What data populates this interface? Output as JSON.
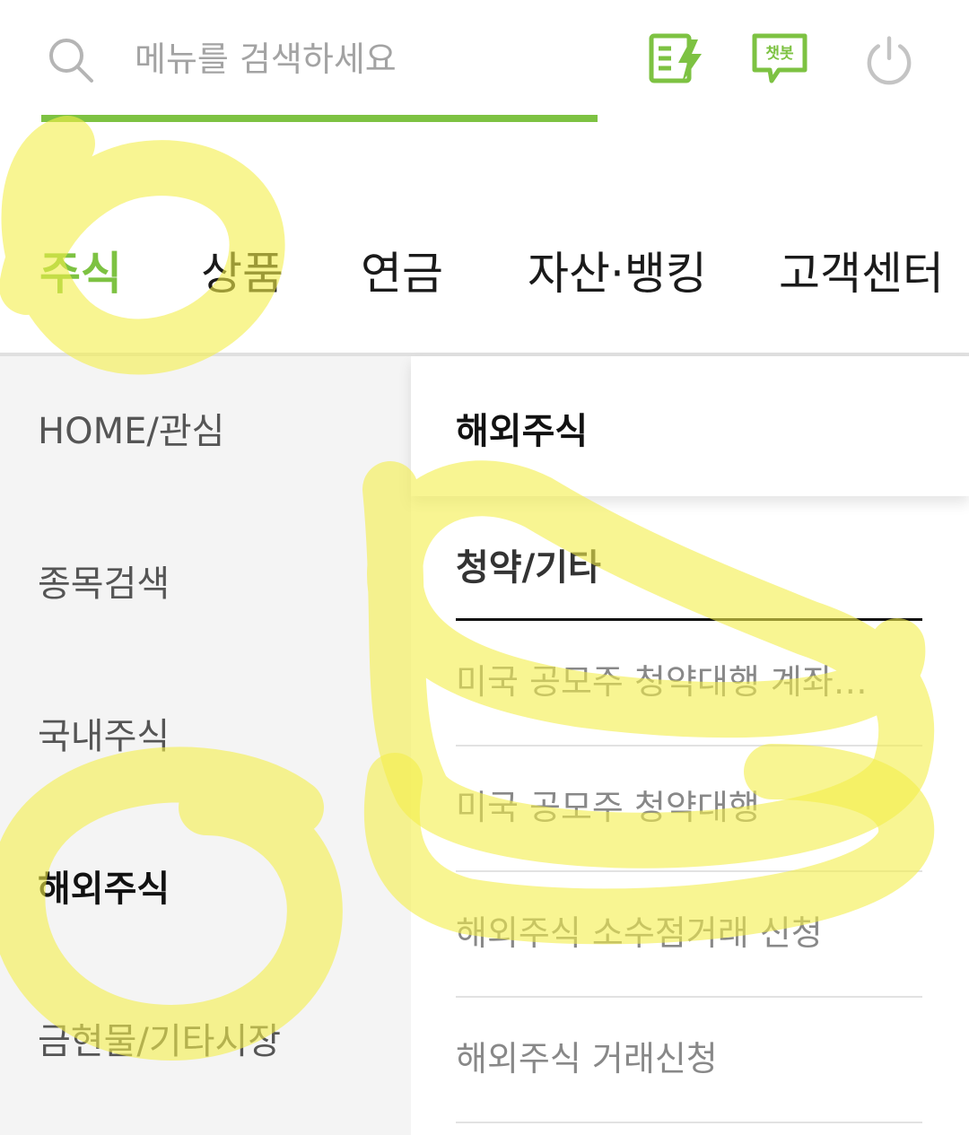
{
  "search": {
    "placeholder": "메뉴를 검색하세요",
    "accent_color": "#7dc242"
  },
  "top_icons": [
    {
      "name": "flash-news-icon"
    },
    {
      "name": "chatbot-icon",
      "label": "챗봇"
    },
    {
      "name": "power-icon"
    }
  ],
  "tabs": [
    {
      "label": "주식",
      "active": true
    },
    {
      "label": "상품",
      "active": false
    },
    {
      "label": "연금",
      "active": false
    },
    {
      "label": "자산·뱅킹",
      "active": false
    },
    {
      "label": "고객센터",
      "active": false
    }
  ],
  "sidebar": {
    "items": [
      {
        "label": "HOME/관심",
        "active": false
      },
      {
        "label": "종목검색",
        "active": false
      },
      {
        "label": "국내주식",
        "active": false
      },
      {
        "label": "해외주식",
        "active": true
      },
      {
        "label": "금현물/기타시장",
        "active": false
      }
    ]
  },
  "panel": {
    "title": "해외주식",
    "section_title": "청약/기타",
    "items": [
      {
        "label": "미국 공모주 청약대행 계좌…"
      },
      {
        "label": "미국 공모주 청약대행"
      },
      {
        "label": "해외주식 소수점거래 신청"
      },
      {
        "label": "해외주식 거래신청"
      }
    ]
  },
  "colors": {
    "accent": "#7dc242",
    "highlighter": "#f5f06a",
    "sidebar_bg": "#f4f4f4"
  }
}
